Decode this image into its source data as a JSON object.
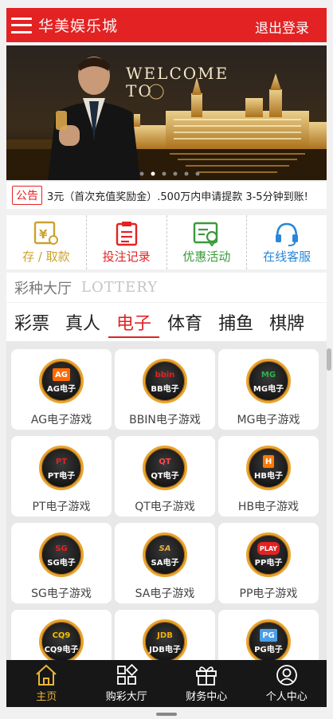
{
  "header": {
    "brand": "华美娱乐城",
    "logout": "退出登录",
    "menu_icon": "hamburger-icon"
  },
  "banner": {
    "headline": "WELCOME",
    "headline2": "TO",
    "active_dot": 1,
    "dots": 6
  },
  "notice": {
    "tag": "公告",
    "text": "3元（首次充值奖励金）.500万内申请提款 3-5分钟到账!"
  },
  "quick_actions": [
    {
      "label": "存 / 取款",
      "icon": "deposit-icon",
      "color": "#caa32b"
    },
    {
      "label": "投注记录",
      "icon": "bet-record-icon",
      "color": "#e32223"
    },
    {
      "label": "优惠活动",
      "icon": "promotion-icon",
      "color": "#3a9a3a"
    },
    {
      "label": "在线客服",
      "icon": "headset-icon",
      "color": "#2a86d8"
    }
  ],
  "lottery": {
    "title_cn": "彩种大厅",
    "title_en": "LOTTERY"
  },
  "tabs": [
    "彩票",
    "真人",
    "电子",
    "体育",
    "捕鱼",
    "棋牌"
  ],
  "active_tab": 2,
  "games": [
    {
      "name": "AG电子游戏",
      "tag": "AG电子",
      "logo": "AG",
      "color": "#ff6a00"
    },
    {
      "name": "BBIN电子游戏",
      "tag": "BB电子",
      "logo": "bbin",
      "color": "#e32223"
    },
    {
      "name": "MG电子游戏",
      "tag": "MG电子",
      "logo": "MG",
      "color": "#2fb24b"
    },
    {
      "name": "PT电子游戏",
      "tag": "PT电子",
      "logo": "PT",
      "color": "#e32223"
    },
    {
      "name": "QT电子游戏",
      "tag": "QT电子",
      "logo": "QT",
      "color": "#ff4a4a"
    },
    {
      "name": "HB电子游戏",
      "tag": "HB电子",
      "logo": "H",
      "color": "#ff7a00"
    },
    {
      "name": "SG电子游戏",
      "tag": "SG电子",
      "logo": "SG",
      "color": "#e32223"
    },
    {
      "name": "SA电子游戏",
      "tag": "SA电子",
      "logo": "SA",
      "color": "#e3b040"
    },
    {
      "name": "PP电子游戏",
      "tag": "PP电子",
      "logo": "PLAY",
      "color": "#f5a000"
    },
    {
      "name": "",
      "tag": "CQ9电子",
      "logo": "CQ9",
      "color": "#f5c000"
    },
    {
      "name": "",
      "tag": "JDB电子",
      "logo": "JDB",
      "color": "#f0b000"
    },
    {
      "name": "",
      "tag": "PG电子",
      "logo": "PG",
      "color": "#4a9ee8"
    }
  ],
  "bottom_nav": [
    {
      "label": "主页",
      "icon": "home-icon"
    },
    {
      "label": "购彩大厅",
      "icon": "apps-icon"
    },
    {
      "label": "财务中心",
      "icon": "gift-icon"
    },
    {
      "label": "个人中心",
      "icon": "user-icon"
    }
  ],
  "bottom_active": 0
}
